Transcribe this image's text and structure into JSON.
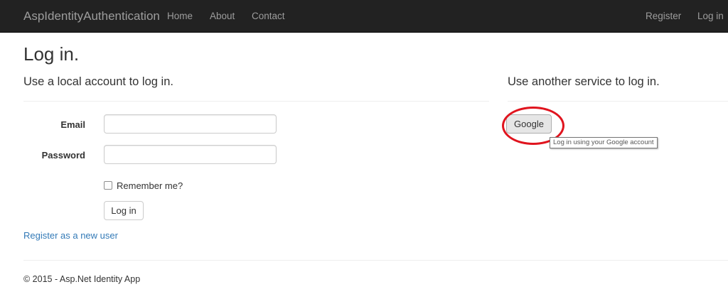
{
  "navbar": {
    "brand": "AspIdentityAuthentication",
    "links": [
      "Home",
      "About",
      "Contact"
    ],
    "right_links": [
      "Register",
      "Log in"
    ]
  },
  "page": {
    "title": "Log in."
  },
  "local": {
    "heading": "Use a local account to log in.",
    "email_label": "Email",
    "email_value": "",
    "password_label": "Password",
    "password_value": "",
    "remember_label": "Remember me?",
    "remember_checked": false,
    "submit_label": "Log in",
    "register_link": "Register as a new user"
  },
  "external": {
    "heading": "Use another service to log in.",
    "google_label": "Google",
    "tooltip": "Log in using your Google account"
  },
  "footer": {
    "text": "© 2015 - Asp.Net Identity App"
  },
  "colors": {
    "navbar_bg": "#222222",
    "nav_text": "#9d9d9d",
    "link": "#337ab7",
    "annotation_circle": "#e0141e"
  }
}
